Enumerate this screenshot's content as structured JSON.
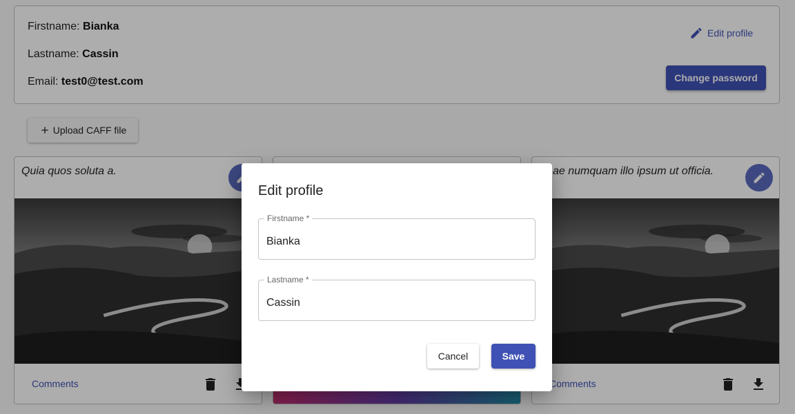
{
  "profile": {
    "firstname_label": "Firstname:",
    "firstname_value": "Bianka",
    "lastname_label": "Lastname:",
    "lastname_value": "Cassin",
    "email_label": "Email:",
    "email_value": "test0@test.com",
    "edit_profile_label": "Edit profile",
    "change_password_label": "Change password"
  },
  "toolbar": {
    "upload_label": "Upload CAFF file"
  },
  "cards": [
    {
      "title": "Quia quos soluta a.",
      "comments_label": "Comments"
    },
    {
      "title": "",
      "comments_label": ""
    },
    {
      "title": "ae numquam illo ipsum ut officia.",
      "comments_label": "Comments"
    }
  ],
  "dialog": {
    "title": "Edit profile",
    "firstname_label": "Firstname *",
    "firstname_value": "Bianka",
    "lastname_label": "Lastname *",
    "lastname_value": "Cassin",
    "cancel_label": "Cancel",
    "save_label": "Save"
  },
  "colors": {
    "primary": "#3f51b5",
    "overlay": "rgba(0,0,0,0.32)"
  },
  "icons": [
    "pencil-icon",
    "plus-icon",
    "trash-icon",
    "download-icon"
  ]
}
